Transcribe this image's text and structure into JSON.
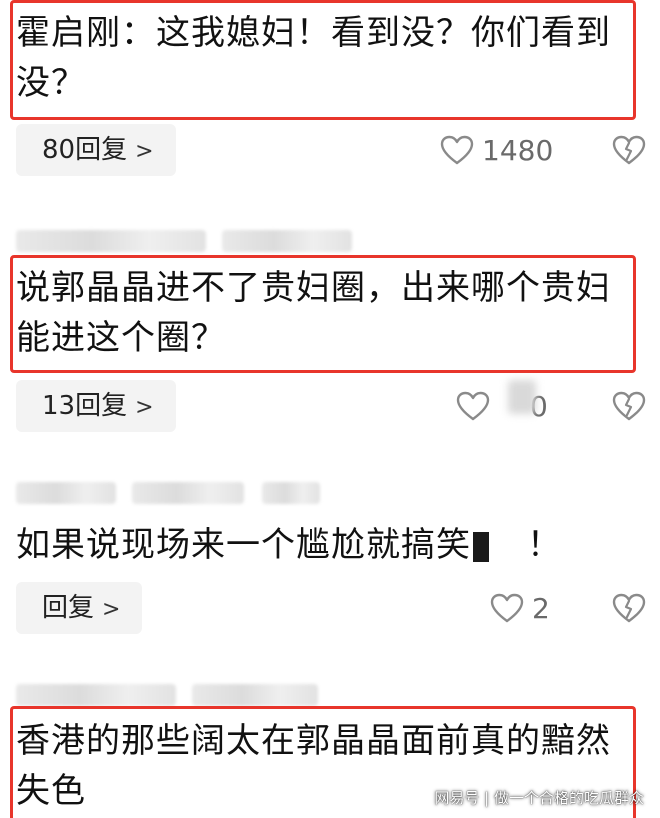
{
  "comments": [
    {
      "text_line1": "霍启刚：这我媳妇！看到没？你们看到",
      "text_line2": "没？",
      "reply_label": "80回复",
      "like_count": "1480"
    },
    {
      "text_line1": "说郭晶晶进不了贵妇圈，出来哪个贵妇",
      "text_line2": "能进这个圈？",
      "reply_label": "13回复",
      "like_count": "0"
    },
    {
      "text_part1": "如果说现场来一个尴尬就搞笑",
      "text_part2": "！",
      "reply_label": "回复",
      "like_count": "2"
    },
    {
      "text_line1": "香港的那些阔太在郭晶晶面前真的黯然",
      "text_line2": "失色"
    }
  ],
  "icons": {
    "reply_chevron": ">",
    "like": "heart-outline-icon",
    "dislike": "broken-heart-icon"
  },
  "watermark": {
    "text": "网易号 | 做一个合格的吃瓜群众"
  },
  "colors": {
    "highlight_border": "#e8352b",
    "reply_bg": "#f3f3f3",
    "icon_gray": "#8a8a8a"
  }
}
